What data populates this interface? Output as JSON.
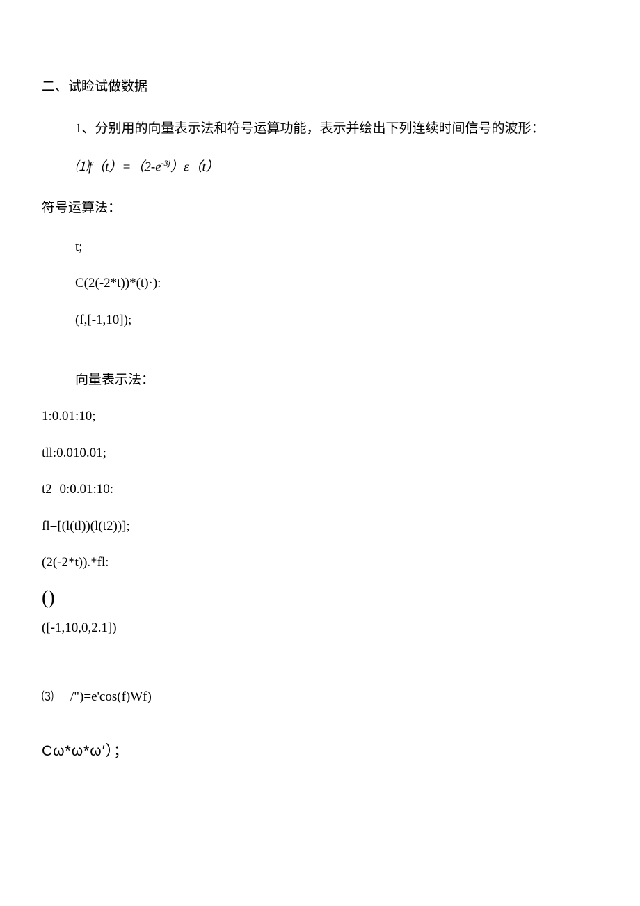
{
  "section": {
    "title": "二、试睑试做数据",
    "q1_intro": "1、分别用的向量表示法和符号运算功能，表示并绘出下列连续时间信号的波形：",
    "formula_prefix": "⑴f（t）=（2-e",
    "formula_exp": "-3j",
    "formula_suffix": "）ε（t）",
    "symbolic_label": "符号运算法：",
    "symbolic_lines": {
      "l1": " t;",
      "l2": "C(2(-2*t))*(t)·):",
      "l3": "(f,[-1,10]);"
    },
    "vector_label": "向量表示法：",
    "vector_lines": {
      "v1": "1:0.01:10;",
      "v2": "tll:0.010.01;",
      "v3": "t2=0:0.01:10:",
      "v4": "fl=[(l(tl))(l(t2))];",
      "v5": "(2(-2*t)).*fl:",
      "v6": "()",
      "v7": "([-1,10,0,2.1])"
    },
    "item3_num": "⑶",
    "item3_body": "/\")=e'cos(f)Wf)",
    "greek": "Cω*ω*ω′）；"
  }
}
